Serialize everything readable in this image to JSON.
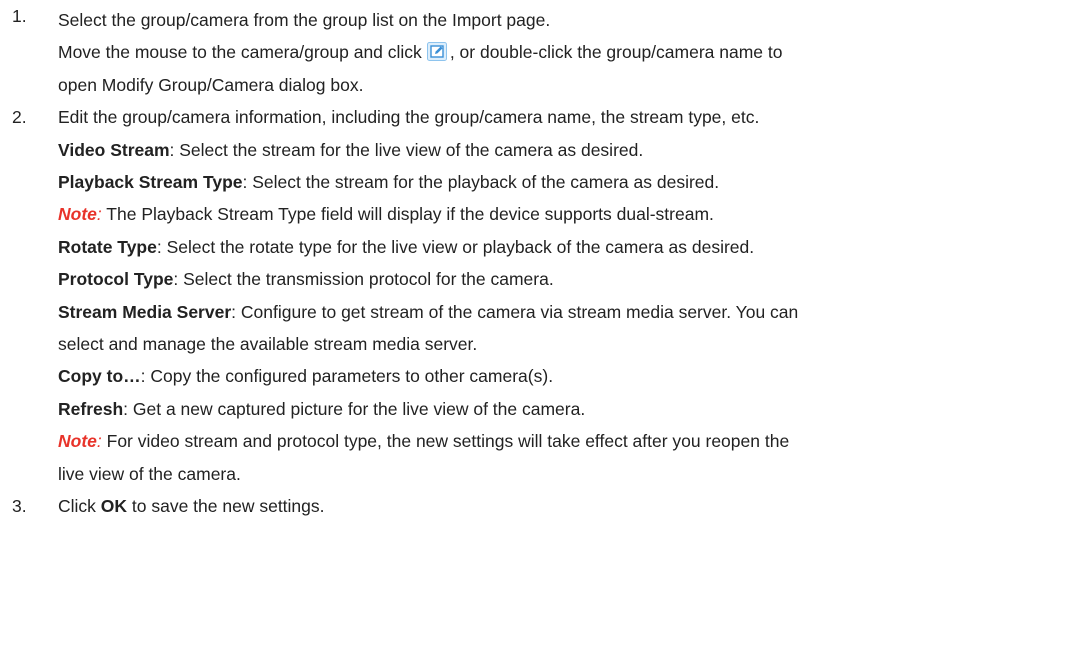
{
  "steps": [
    {
      "number": "1.",
      "line1": "Select the group/camera from the group list on the Import page.",
      "line2_before_icon": "Move the mouse to the camera/group and click",
      "line2_after_icon": ", or double-click the group/camera name to",
      "line3": "open Modify Group/Camera dialog box."
    },
    {
      "number": "2.",
      "intro": "Edit the group/camera information, including the group/camera name, the stream type, etc.",
      "params": [
        {
          "label": "Video Stream",
          "text": ": Select the stream for the live view of the camera as desired."
        },
        {
          "label": "Playback Stream Type",
          "text": ": Select the stream for the playback of the camera as desired."
        }
      ],
      "note1": {
        "label": "Note",
        "colon": ":",
        "text": " The Playback Stream Type field will display if the device supports dual-stream."
      },
      "params2": [
        {
          "label": "Rotate Type",
          "text": ": Select the rotate type for the live view or playback of the camera as desired."
        },
        {
          "label": "Protocol Type",
          "text": ": Select the transmission protocol for the camera."
        },
        {
          "label": "Stream Media Server",
          "text": ": Configure to get stream of the camera via stream media server. You can"
        }
      ],
      "stream_media_cont": "select and manage the available stream media server.",
      "params3": [
        {
          "label": "Copy to…",
          "text": ": Copy the configured parameters to other camera(s)."
        },
        {
          "label": "Refresh",
          "text": ": Get a new captured picture for the live view of the camera."
        }
      ],
      "note2": {
        "label": "Note",
        "colon": ":",
        "text": " For video stream and protocol type, the new settings will take effect after you reopen the"
      },
      "note2_cont": "live view of the camera."
    },
    {
      "number": "3.",
      "before": "Click ",
      "bold": "OK",
      "after": " to save the new settings."
    }
  ],
  "icons": {
    "edit": "edit-icon",
    "edit_color": "#3a8fd6"
  },
  "colors": {
    "note": "#e8332a",
    "text": "#222222"
  }
}
